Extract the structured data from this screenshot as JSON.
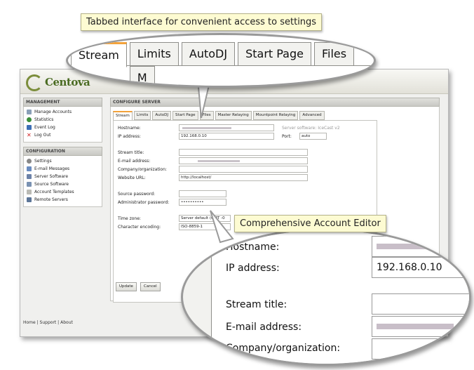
{
  "callouts": {
    "tabs_caption": "Tabbed interface for convenient access to settings",
    "editor_caption": "Comprehensive Account Editor"
  },
  "app": {
    "logo_text": "Centova"
  },
  "sidebar": {
    "management_header": "MANAGEMENT",
    "management_items": [
      {
        "label": "Manage Accounts",
        "icon": "accounts-icon"
      },
      {
        "label": "Statistics",
        "icon": "statistics-icon"
      },
      {
        "label": "Event Log",
        "icon": "event-log-icon"
      },
      {
        "label": "Log Out",
        "icon": "logout-icon"
      }
    ],
    "configuration_header": "CONFIGURATION",
    "configuration_items": [
      {
        "label": "Settings",
        "icon": "settings-icon"
      },
      {
        "label": "E-mail Messages",
        "icon": "email-icon"
      },
      {
        "label": "Server Software",
        "icon": "server-software-icon"
      },
      {
        "label": "Source Software",
        "icon": "source-software-icon"
      },
      {
        "label": "Account Templates",
        "icon": "templates-icon"
      },
      {
        "label": "Remote Servers",
        "icon": "remote-servers-icon"
      }
    ],
    "footer": "Home | Support | About"
  },
  "content": {
    "header": "CONFIGURE SERVER",
    "tabs": [
      "Stream",
      "Limits",
      "AutoDJ",
      "Start Page",
      "Files",
      "Master Relaying",
      "Mountpoint Relaying",
      "Advanced"
    ],
    "active_tab": "Stream",
    "form": {
      "hostname_label": "Hostname:",
      "ip_label": "IP address:",
      "ip_value": "192.168.0.10",
      "server_software": "Server software: IceCast v2",
      "port_label": "Port:",
      "port_value": "auto",
      "stream_title_label": "Stream title:",
      "email_label": "E-mail address:",
      "company_label": "Company/organization:",
      "website_label": "Website URL:",
      "website_value": "http://localhost/",
      "source_password_label": "Source password:",
      "admin_password_label": "Administrator password:",
      "admin_password_value": "••••••••••",
      "timezone_label": "Time zone:",
      "timezone_value": "Server default (GMT -0",
      "encoding_label": "Character encoding:",
      "encoding_value": "ISO-8859-1"
    },
    "update_button": "Update",
    "cancel_button": "Cancel"
  },
  "magnified_tabs": [
    "Stream",
    "Limits",
    "AutoDJ",
    "Start Page",
    "Files",
    "M"
  ],
  "magnified_form": {
    "hostname_label": "Hostname:",
    "ip_label": "IP address:",
    "ip_value": "192.168.0.10",
    "stream_title_label": "Stream title:",
    "email_label": "E-mail address:",
    "company_label": "Company/organization:"
  },
  "colors": {
    "active_tab_accent": "#f3a23a",
    "caption_bg": "#fdfbd2",
    "logo_green": "#4a6b22"
  }
}
